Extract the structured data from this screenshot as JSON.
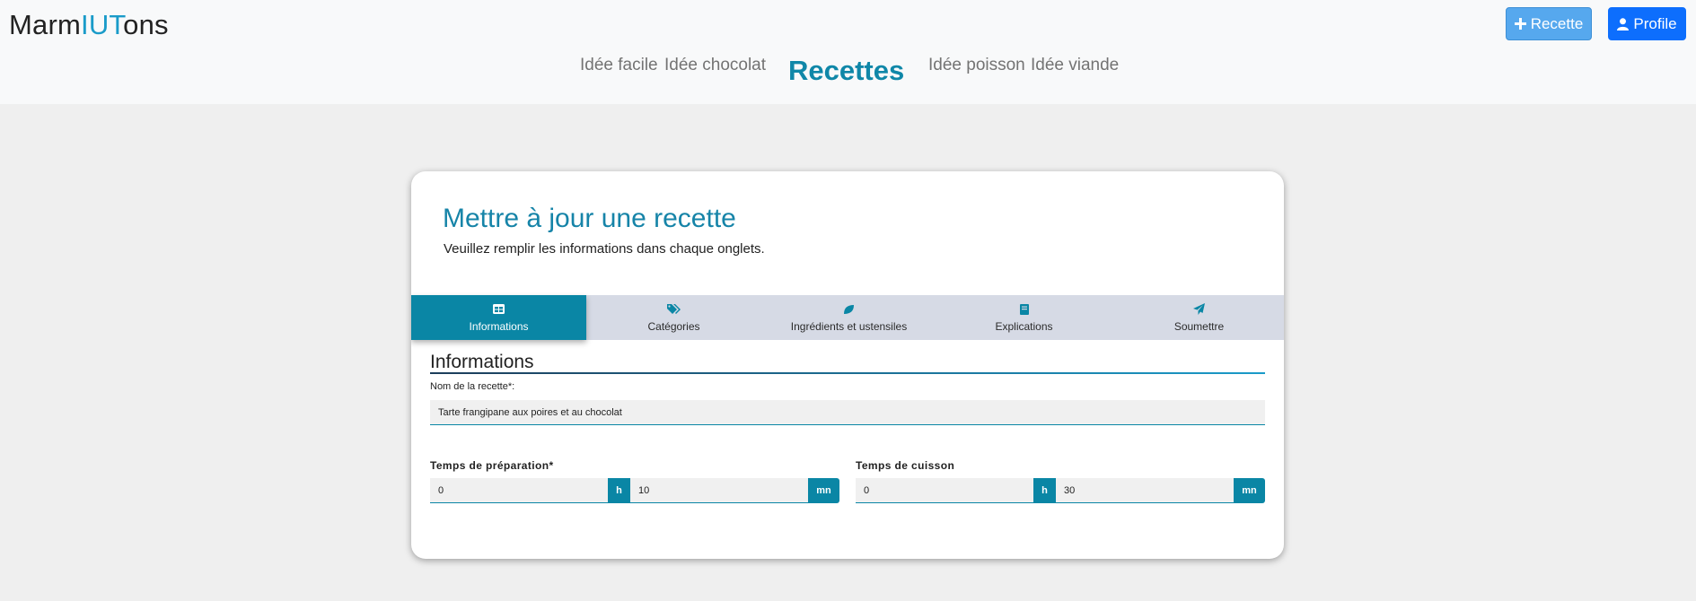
{
  "app": {
    "logo_prefix": "Marm",
    "logo_accent": "IUT",
    "logo_suffix": "ons"
  },
  "header": {
    "recette_button": "Recette",
    "profile_button": "Profile",
    "nav_left": [
      "Idée facile",
      "Idée chocolat"
    ],
    "nav_title": "Recettes",
    "nav_right": [
      "Idée poisson",
      "Idée viande"
    ]
  },
  "card": {
    "title": "Mettre à jour une recette",
    "subtitle": "Veuillez remplir les informations dans chaque onglets."
  },
  "tabs": [
    {
      "label": "Informations",
      "icon": "table-icon",
      "active": true
    },
    {
      "label": "Catégories",
      "icon": "tags-icon",
      "active": false
    },
    {
      "label": "Ingrédients et ustensiles",
      "icon": "leaf-icon",
      "active": false
    },
    {
      "label": "Explications",
      "icon": "book-icon",
      "active": false
    },
    {
      "label": "Soumettre",
      "icon": "send-icon",
      "active": false
    }
  ],
  "form": {
    "section_title": "Informations",
    "name_label": "Nom de la recette*:",
    "name_value": "Tarte frangipane aux poires et au chocolat",
    "prep_label": "Temps de préparation*",
    "prep_hours": "0",
    "prep_minutes": "10",
    "cook_label": "Temps de cuisson",
    "cook_hours": "0",
    "cook_minutes": "30",
    "hours_unit": "h",
    "minutes_unit": "mn"
  },
  "colors": {
    "accent": "#0a86a5",
    "primary_button": "#0d6efd",
    "secondary_button": "#56a8ee",
    "tab_bar": "#d6dae5",
    "page_bg": "#efefef"
  }
}
